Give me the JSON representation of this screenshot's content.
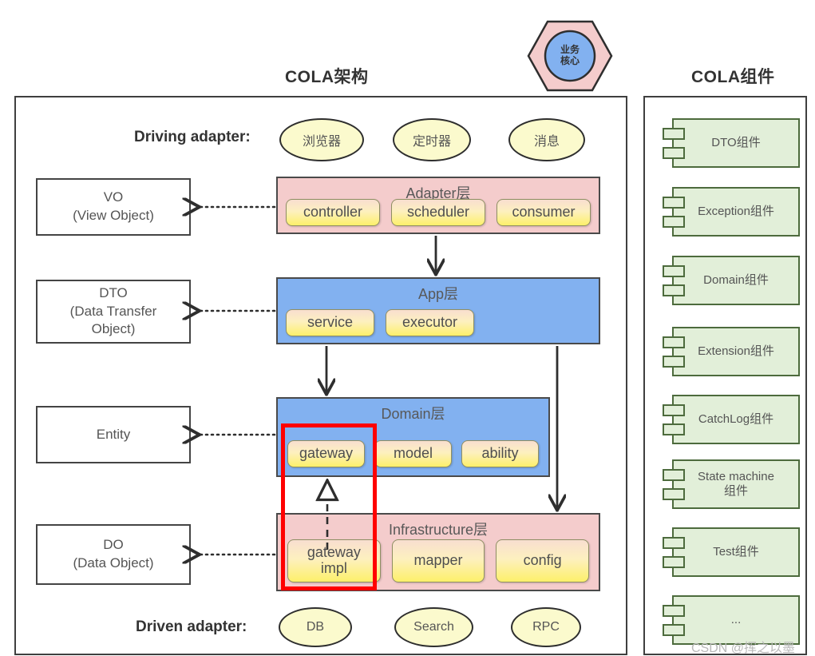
{
  "titles": {
    "left": "COLA架构",
    "right": "COLA组件"
  },
  "core_hexagon": {
    "line1": "业务",
    "line2": "核心",
    "hex_fill": "#f4cccc",
    "circle_fill": "#82b1f0"
  },
  "labels": {
    "driving_adapter": "Driving adapter:",
    "driven_adapter": "Driven adapter:"
  },
  "driving_adapters": [
    {
      "name": "浏览器"
    },
    {
      "name": "定时器"
    },
    {
      "name": "消息"
    }
  ],
  "driven_adapters": [
    {
      "name": "DB"
    },
    {
      "name": "Search"
    },
    {
      "name": "RPC"
    }
  ],
  "objects": [
    {
      "name": "VO\n(View Object)"
    },
    {
      "name": "DTO\n(Data Transfer\nObject)"
    },
    {
      "name": "Entity"
    },
    {
      "name": "DO\n(Data Object)"
    }
  ],
  "layers": [
    {
      "title": "Adapter层",
      "color": "#f4cccc",
      "chips": [
        "controller",
        "scheduler",
        "consumer"
      ]
    },
    {
      "title": "App层",
      "color": "#82b1f0",
      "chips": [
        "service",
        "executor"
      ]
    },
    {
      "title": "Domain层",
      "color": "#82b1f0",
      "chips": [
        "gateway",
        "model",
        "ability"
      ]
    },
    {
      "title": "Infrastructure层",
      "color": "#f4cccc",
      "chips": [
        "gateway\nimpl",
        "mapper",
        "config"
      ]
    }
  ],
  "components": [
    {
      "label": "DTO组件"
    },
    {
      "label": "Exception组件"
    },
    {
      "label": "Domain组件"
    },
    {
      "label": "Extension组件"
    },
    {
      "label": "CatchLog组件"
    },
    {
      "label": "State machine\n组件"
    },
    {
      "label": "Test组件"
    },
    {
      "label": "..."
    }
  ],
  "highlight": {
    "color": "#ff0000",
    "targets": [
      "gateway",
      "gateway impl"
    ]
  },
  "watermark": "CSDN @挥之以墨"
}
